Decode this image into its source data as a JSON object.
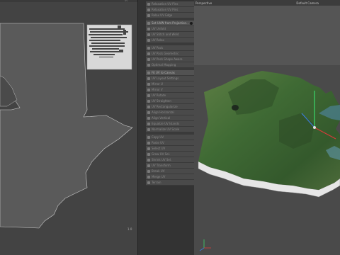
{
  "uv_editor": {
    "view_title": "",
    "corner_label": "1.0",
    "header_tag": "UV"
  },
  "tool_panel": {
    "items": [
      {
        "label": "Relaxation UV Pins",
        "state": "dim"
      },
      {
        "label": "Relaxation UV Pins",
        "state": "dim"
      },
      {
        "label": "Relax UV Edge",
        "state": "dim"
      },
      {
        "label": "Set UVW from Projection...",
        "state": "active"
      },
      {
        "label": "UV Unfold",
        "state": "dim"
      },
      {
        "label": "UV Stitch and Weld",
        "state": "dim"
      },
      {
        "label": "UV Relax",
        "state": "dim"
      },
      {
        "label": "UV Pack",
        "state": "dim"
      },
      {
        "label": "UV Pack Geometric",
        "state": "dim"
      },
      {
        "label": "UV Pack Shape Aware",
        "state": "dim"
      },
      {
        "label": "Optimal Mapping",
        "state": "dim"
      },
      {
        "label": "Fit UV to Canvas",
        "state": "active"
      },
      {
        "label": "UV Layout Settings",
        "state": "dim"
      },
      {
        "label": "Mirror U",
        "state": "dim"
      },
      {
        "label": "Mirror V",
        "state": "dim"
      },
      {
        "label": "UV Rotate",
        "state": "dim"
      },
      {
        "label": "UV Straighten",
        "state": "dim"
      },
      {
        "label": "UV Rectangularize",
        "state": "dim"
      },
      {
        "label": "Align Horizontal",
        "state": "dim"
      },
      {
        "label": "Align Vertical",
        "state": "dim"
      },
      {
        "label": "Equalize UV Islands",
        "state": "dim"
      },
      {
        "label": "Normalize UV Scale",
        "state": "dim"
      },
      {
        "label": "Copy UV",
        "state": "dim"
      },
      {
        "label": "Paste UV",
        "state": "dim"
      },
      {
        "label": "Select UV",
        "state": "dim"
      },
      {
        "label": "Grow UV Sel.",
        "state": "dim"
      },
      {
        "label": "Shrink UV Sel.",
        "state": "dim"
      },
      {
        "label": "UV Transform",
        "state": "dim"
      },
      {
        "label": "Break UV",
        "state": "dim"
      },
      {
        "label": "Merge UV",
        "state": "dim"
      },
      {
        "label": "Terrain",
        "state": "dim"
      }
    ]
  },
  "viewport": {
    "title": "Perspective",
    "camera": "Default Camera",
    "axis_colors": {
      "x": "#d83a3a",
      "y": "#3ad86a",
      "z": "#3a7ad8"
    }
  },
  "colors": {
    "uv_background": "#434343",
    "uv_shape": "#5a5a5a",
    "terrain_green": "#3f6a34",
    "terrain_side": "#e6e6e6"
  }
}
